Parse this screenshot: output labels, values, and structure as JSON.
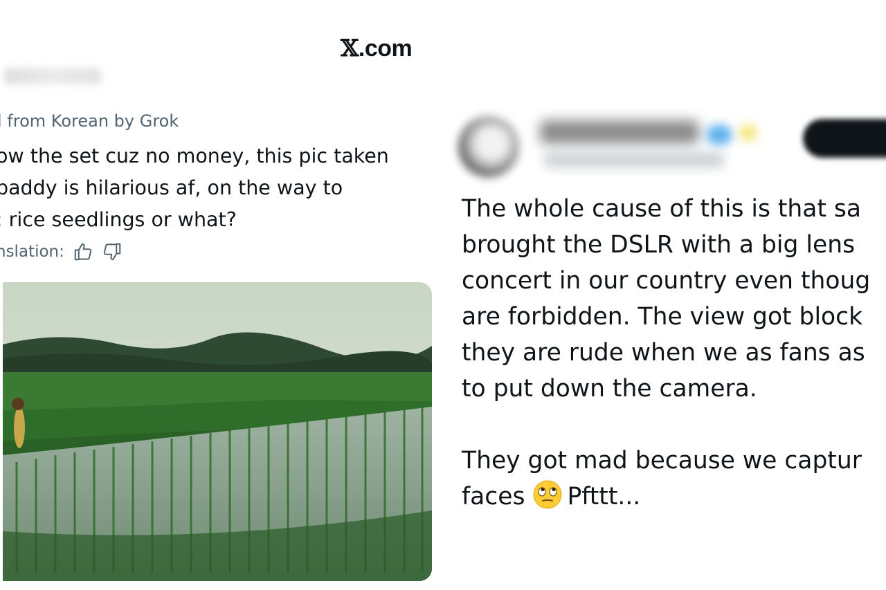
{
  "header": {
    "brand_text": ".com",
    "brand_icon": "x-logo"
  },
  "left_tweet": {
    "translated_label": "l from Korean by Grok",
    "translated_lines": [
      "ow the set cuz no money, this pic taken",
      " paddy is hilarious af, on the way to",
      ": rice seedlings or what?"
    ],
    "rate_label": "nslation:",
    "rate_icons": [
      "thumbs-up-icon",
      "thumbs-down-icon"
    ],
    "media": {
      "description_icon": "rice-paddy-photo"
    }
  },
  "right_tweet": {
    "paragraph1": [
      "The whole cause of this is that sa",
      "brought the DSLR with a big lens",
      "concert in our country even thoug",
      "are forbidden. The view got block",
      "they are rude when we as fans as",
      "to put down the camera."
    ],
    "paragraph2_line1": "They got mad because we captur",
    "paragraph2_line2_before": "faces",
    "paragraph2_line2_after": "Pfttt...",
    "emoji_icon": "face-with-rolling-eyes-emoji"
  },
  "colors": {
    "text": "#0f1419",
    "muted": "#536471",
    "background": "#ffffff"
  }
}
